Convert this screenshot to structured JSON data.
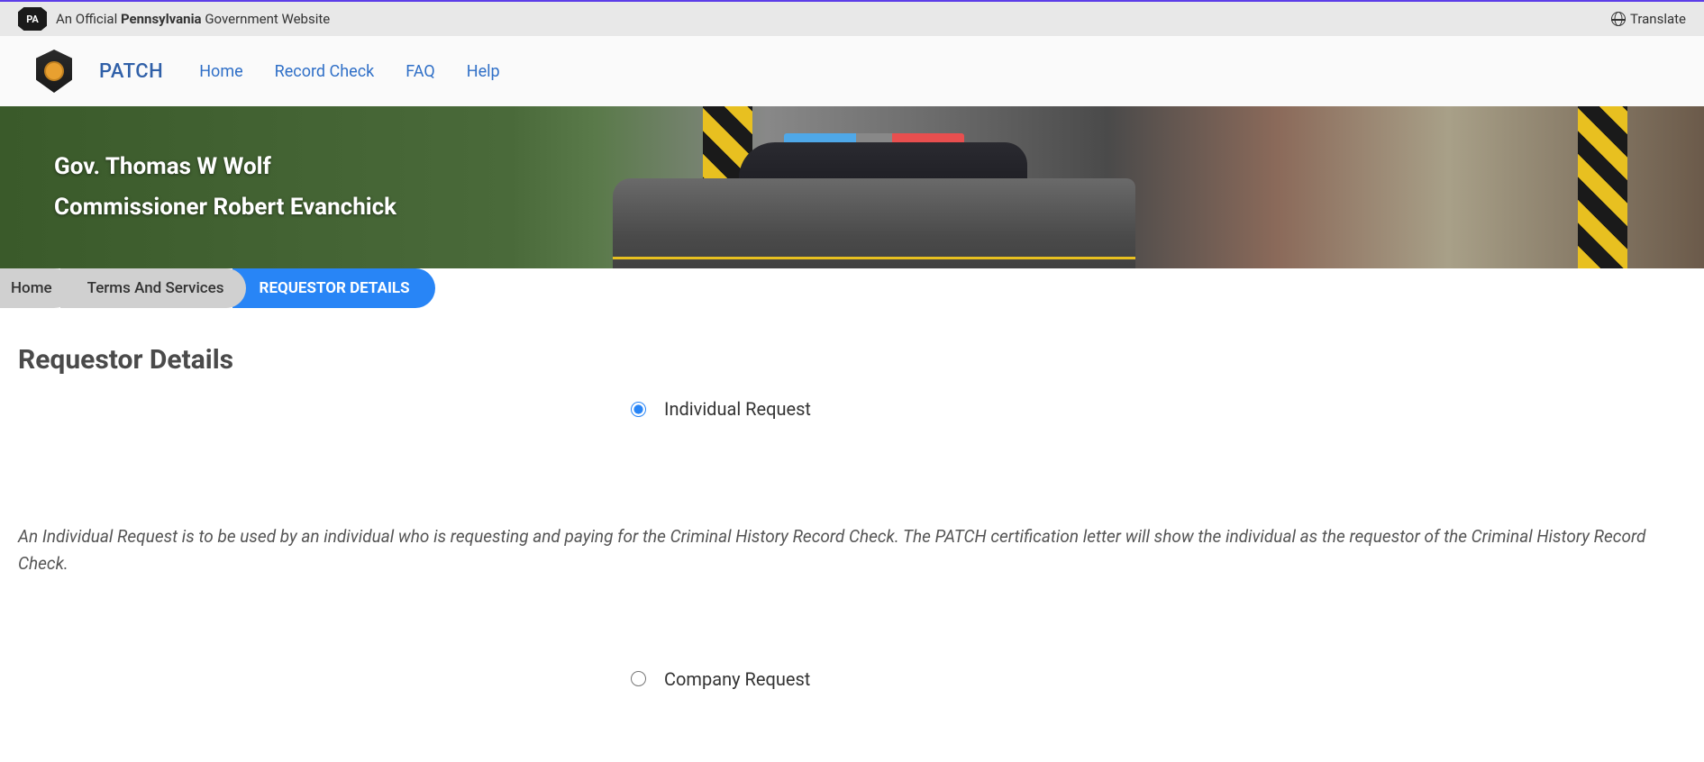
{
  "topbar": {
    "text_prefix": "An Official ",
    "text_bold": "Pennsylvania",
    "text_suffix": " Government Website",
    "translate_label": "Translate"
  },
  "nav": {
    "brand": "PATCH",
    "links": {
      "home": "Home",
      "record_check": "Record Check",
      "faq": "FAQ",
      "help": "Help"
    }
  },
  "hero": {
    "governor": "Gov. Thomas W Wolf",
    "commissioner": "Commissioner Robert Evanchick"
  },
  "breadcrumb": {
    "home": "Home",
    "terms": "Terms And Services",
    "current": "REQUESTOR DETAILS"
  },
  "page": {
    "title": "Requestor Details",
    "options": {
      "individual": {
        "label": "Individual Request",
        "checked": true,
        "description": "An Individual Request is to be used by an individual who is requesting and paying for the Criminal History Record Check. The PATCH certification letter will show the individual as the requestor of the Criminal History Record Check."
      },
      "company": {
        "label": "Company Request",
        "checked": false
      }
    }
  }
}
